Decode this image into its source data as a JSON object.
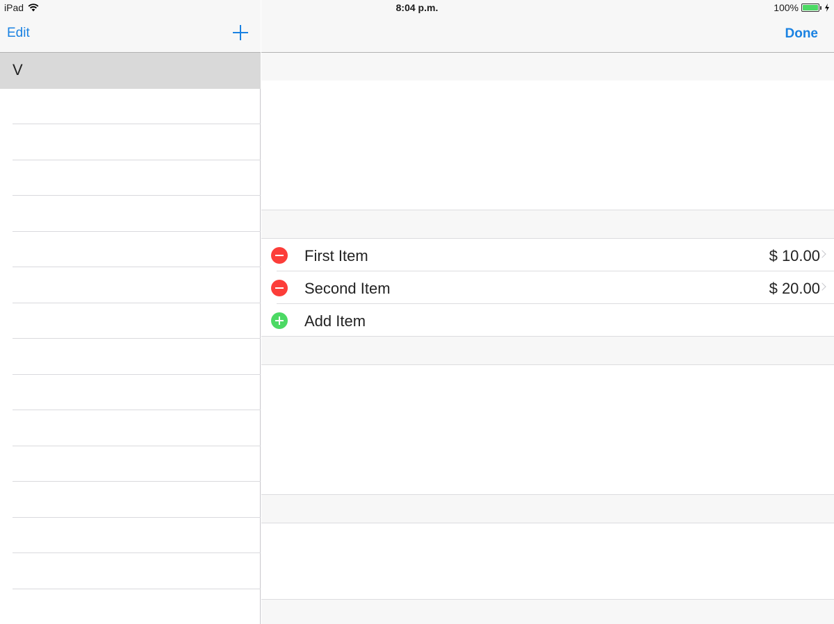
{
  "status_bar": {
    "device": "iPad",
    "time": "8:04 p.m.",
    "battery_percent": "100%",
    "battery_level": 1.0,
    "wifi_icon": "wifi-icon",
    "charging_icon": "bolt-icon"
  },
  "master": {
    "edit_label": "Edit",
    "add_icon": "plus-icon",
    "rows": [
      "V",
      "",
      "",
      "",
      "",
      "",
      "",
      "",
      "",
      "",
      "",
      "",
      "",
      "",
      "",
      ""
    ]
  },
  "detail": {
    "done_label": "Done",
    "items": [
      {
        "label": "First Item",
        "price": "$ 10.00",
        "action": "delete"
      },
      {
        "label": "Second Item",
        "price": "$ 20.00",
        "action": "delete"
      }
    ],
    "add_item_label": "Add Item"
  },
  "colors": {
    "accent": "#1a82e2",
    "delete": "#fc3d39",
    "add": "#4cd964",
    "selected_row": "#d9d9d9"
  }
}
